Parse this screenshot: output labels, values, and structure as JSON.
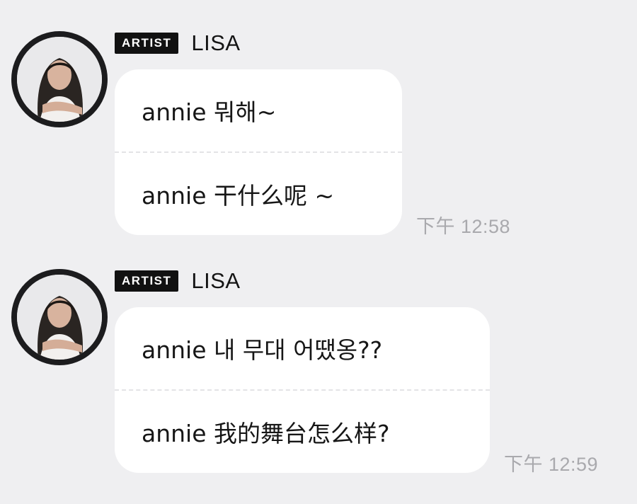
{
  "messages": [
    {
      "badge": "ARTIST",
      "sender": "LISA",
      "lines": [
        "annie 뭐해~",
        "annie 干什么呢 ~"
      ],
      "time": "下午 12:58"
    },
    {
      "badge": "ARTIST",
      "sender": "LISA",
      "lines": [
        "annie 내 무대 어땠옹??",
        "annie 我的舞台怎么样?"
      ],
      "time": "下午 12:59"
    }
  ],
  "icons": {
    "avatar": "profile-photo"
  },
  "colors": {
    "background": "#efeff1",
    "bubble": "#ffffff",
    "badge": "#111111",
    "avatar_ring": "#1c1c1e",
    "timestamp": "#a9a9ad"
  }
}
